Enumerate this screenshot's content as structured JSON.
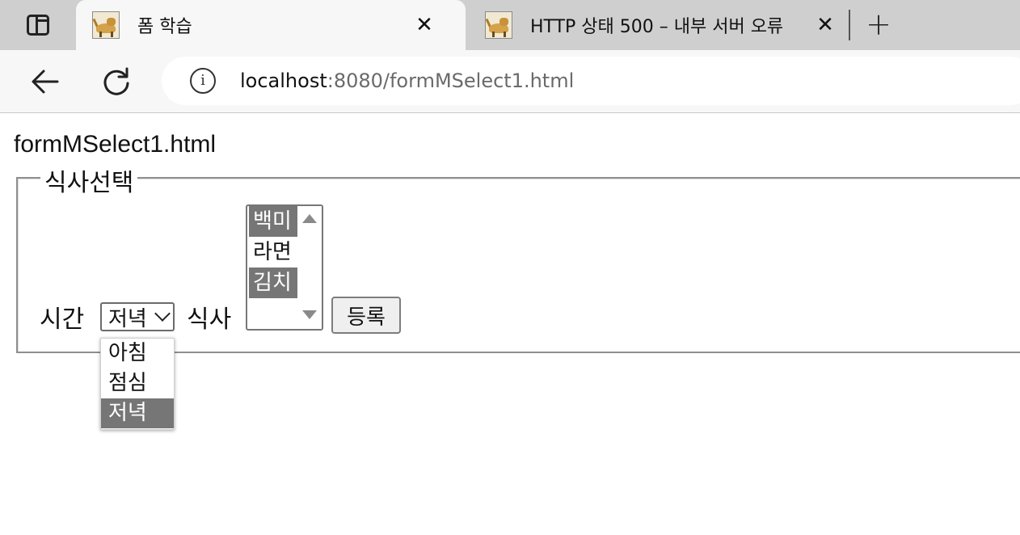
{
  "browser": {
    "tabs": [
      {
        "title": "폼 학습",
        "active": true
      },
      {
        "title": "HTTP 상태 500 – 내부 서버 오류",
        "active": false
      }
    ],
    "close_glyph": "✕",
    "new_tab_glyph": "+",
    "address": {
      "host": "localhost",
      "rest": ":8080/formMSelect1.html"
    },
    "colors": {
      "tabstrip": "#cfcfcf",
      "toolbar": "#f7f7f7",
      "url_muted": "#6a6a6a"
    }
  },
  "page": {
    "heading": "formMSelect1.html",
    "form": {
      "legend": "식사선택",
      "time_label": "시간",
      "time_select": {
        "value": "저녁",
        "options": [
          {
            "label": "아침",
            "selected": false
          },
          {
            "label": "점심",
            "selected": false
          },
          {
            "label": "저녁",
            "selected": true
          }
        ]
      },
      "meal_label": "식사",
      "meal_listbox": {
        "options": [
          {
            "label": "백미",
            "selected": true
          },
          {
            "label": "라면",
            "selected": false
          },
          {
            "label": "김치",
            "selected": true
          }
        ]
      },
      "submit_label": "등록"
    },
    "colors": {
      "selected_option_bg": "#767676"
    }
  },
  "icons": {
    "tab_actions": "tab-actions-icon",
    "favicon": "tomcat-icon",
    "back": "back-arrow-icon",
    "reload": "reload-icon",
    "info": "info-icon"
  }
}
